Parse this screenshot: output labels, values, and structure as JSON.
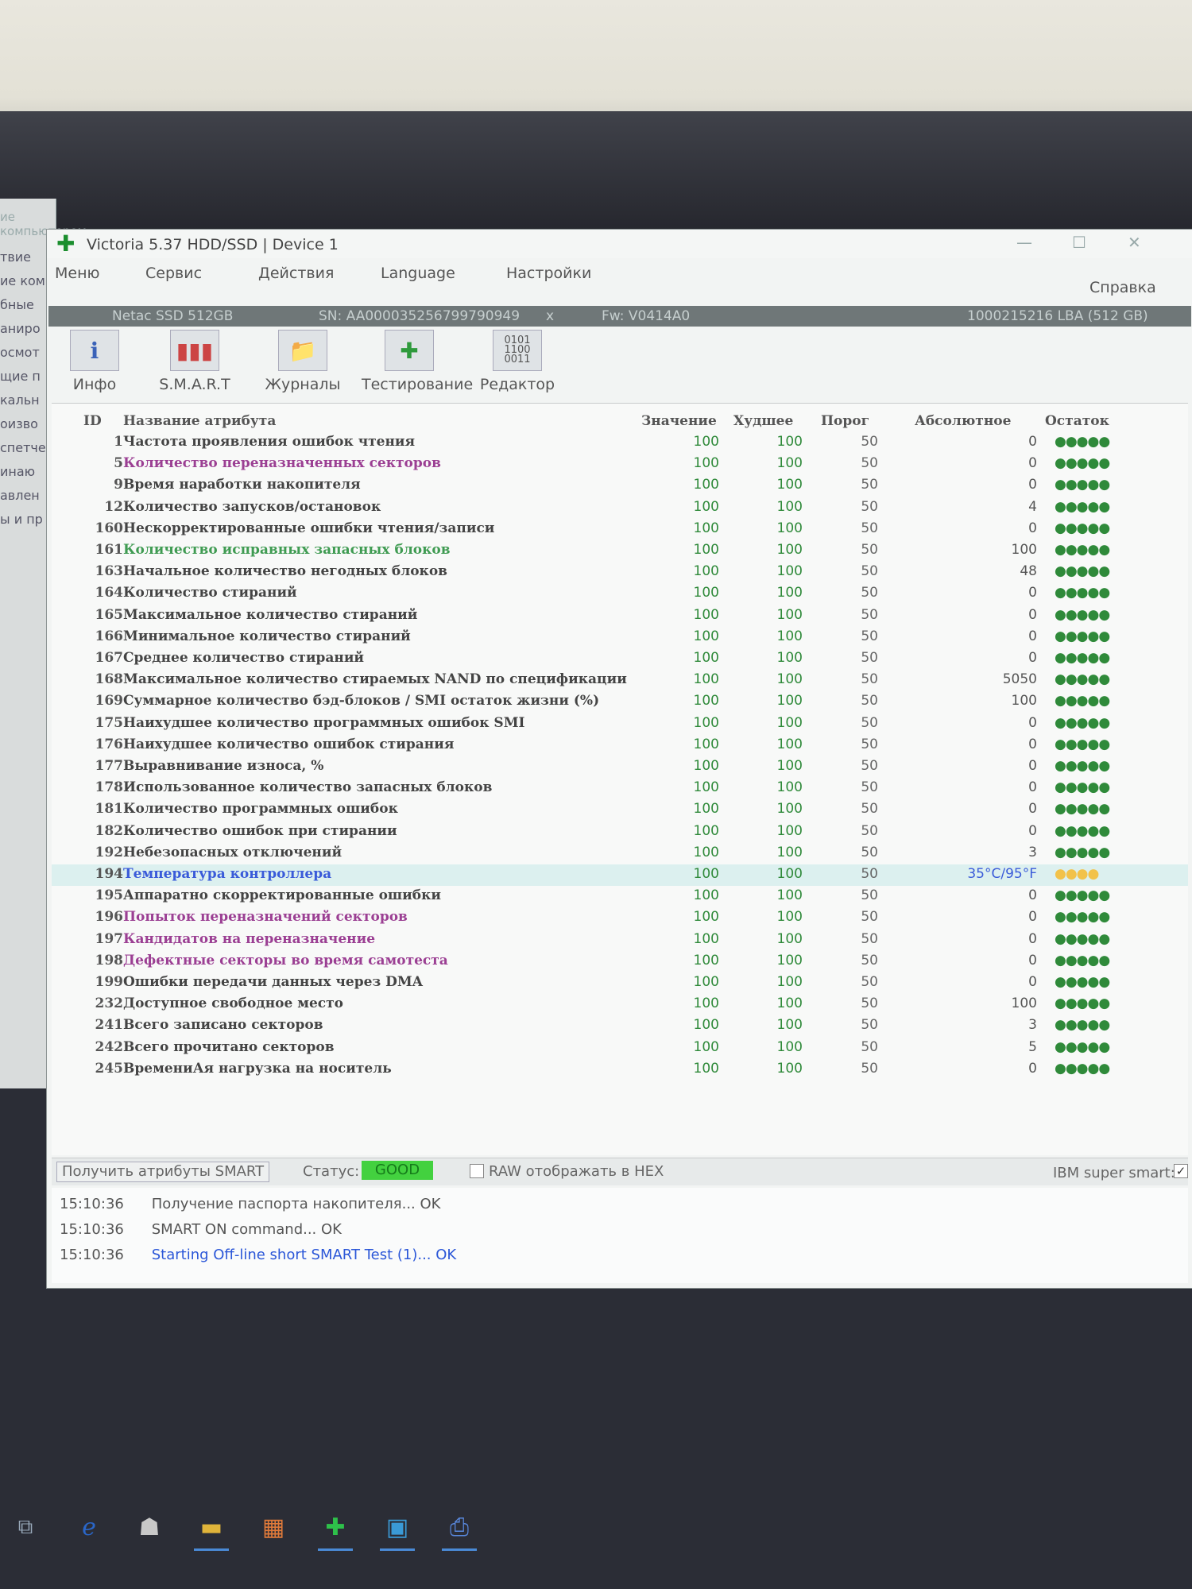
{
  "background_window": {
    "title": "ие компьютером",
    "lines": [
      "твие",
      "ие ком",
      "бные",
      "аниро",
      "осмот",
      "щие п",
      "кальн",
      "оизво",
      "спетче",
      "инаю",
      "авлен",
      "ы и пр"
    ]
  },
  "window": {
    "title": "Victoria 5.37 HDD/SSD | Device 1",
    "app_icon": "green-cross-icon",
    "controls": [
      "—",
      "☐",
      "✕"
    ]
  },
  "menu": [
    "Меню",
    "Сервис",
    "Действия",
    "Language",
    "Настройки",
    "Справка"
  ],
  "device": {
    "model": "Netac SSD 512GB",
    "serial": "SN: AA000035256799790949",
    "serial_close": "x",
    "firmware": "Fw: V0414A0",
    "capacity": "1000215216 LBA (512 GB)"
  },
  "toolbar": [
    {
      "label": "Инфо",
      "icon": "info-icon"
    },
    {
      "label": "S.M.A.R.T",
      "icon": "smart-chart-icon"
    },
    {
      "label": "Журналы",
      "icon": "logs-folder-icon"
    },
    {
      "label": "Тестирование",
      "icon": "test-icon"
    },
    {
      "label": "Редактор",
      "icon": "hex-editor-icon"
    }
  ],
  "smart_table": {
    "columns": [
      "ID",
      "Название атрибута",
      "Значение",
      "Худшее",
      "Порог",
      "Абсолютное",
      "Остаток"
    ],
    "rows": [
      {
        "id": "1",
        "name": "Частота проявления ошибок чтения",
        "value": "100",
        "worst": "100",
        "threshold": "50",
        "raw": "0",
        "remaining": "●●●●●",
        "name_color": "#444444"
      },
      {
        "id": "5",
        "name": "Количество переназначенных секторов",
        "value": "100",
        "worst": "100",
        "threshold": "50",
        "raw": "0",
        "remaining": "●●●●●",
        "name_color": "#9b3f93"
      },
      {
        "id": "9",
        "name": "Время наработки накопителя",
        "value": "100",
        "worst": "100",
        "threshold": "50",
        "raw": "0",
        "remaining": "●●●●●",
        "name_color": "#444444"
      },
      {
        "id": "12",
        "name": "Количество запусков/остановок",
        "value": "100",
        "worst": "100",
        "threshold": "50",
        "raw": "4",
        "remaining": "●●●●●",
        "name_color": "#444444"
      },
      {
        "id": "160",
        "name": "Нескорректированные ошибки чтения/записи",
        "value": "100",
        "worst": "100",
        "threshold": "50",
        "raw": "0",
        "remaining": "●●●●●",
        "name_color": "#444444"
      },
      {
        "id": "161",
        "name": "Количество исправных запасных блоков",
        "value": "100",
        "worst": "100",
        "threshold": "50",
        "raw": "100",
        "remaining": "●●●●●",
        "name_color": "#3f9b52"
      },
      {
        "id": "163",
        "name": "Начальное количество негодных блоков",
        "value": "100",
        "worst": "100",
        "threshold": "50",
        "raw": "48",
        "remaining": "●●●●●",
        "name_color": "#444444"
      },
      {
        "id": "164",
        "name": "Количество стираний",
        "value": "100",
        "worst": "100",
        "threshold": "50",
        "raw": "0",
        "remaining": "●●●●●",
        "name_color": "#444444"
      },
      {
        "id": "165",
        "name": "Максимальное количество стираний",
        "value": "100",
        "worst": "100",
        "threshold": "50",
        "raw": "0",
        "remaining": "●●●●●",
        "name_color": "#444444"
      },
      {
        "id": "166",
        "name": "Минимальное количество стираний",
        "value": "100",
        "worst": "100",
        "threshold": "50",
        "raw": "0",
        "remaining": "●●●●●",
        "name_color": "#444444"
      },
      {
        "id": "167",
        "name": "Среднее количество стираний",
        "value": "100",
        "worst": "100",
        "threshold": "50",
        "raw": "0",
        "remaining": "●●●●●",
        "name_color": "#444444"
      },
      {
        "id": "168",
        "name": "Максимальное количество стираемых NAND по спецификации",
        "value": "100",
        "worst": "100",
        "threshold": "50",
        "raw": "5050",
        "remaining": "●●●●●",
        "name_color": "#444444"
      },
      {
        "id": "169",
        "name": "Суммарное количество бэд-блоков / SMI остаток жизни (%)",
        "value": "100",
        "worst": "100",
        "threshold": "50",
        "raw": "100",
        "remaining": "●●●●●",
        "name_color": "#444444"
      },
      {
        "id": "175",
        "name": "Наихудшее количество программных ошибок SMI",
        "value": "100",
        "worst": "100",
        "threshold": "50",
        "raw": "0",
        "remaining": "●●●●●",
        "name_color": "#444444"
      },
      {
        "id": "176",
        "name": "Наихудшее количество ошибок стирания",
        "value": "100",
        "worst": "100",
        "threshold": "50",
        "raw": "0",
        "remaining": "●●●●●",
        "name_color": "#444444"
      },
      {
        "id": "177",
        "name": "Выравнивание износа, %",
        "value": "100",
        "worst": "100",
        "threshold": "50",
        "raw": "0",
        "remaining": "●●●●●",
        "name_color": "#444444"
      },
      {
        "id": "178",
        "name": "Использованное количество запасных блоков",
        "value": "100",
        "worst": "100",
        "threshold": "50",
        "raw": "0",
        "remaining": "●●●●●",
        "name_color": "#444444"
      },
      {
        "id": "181",
        "name": "Количество программных ошибок",
        "value": "100",
        "worst": "100",
        "threshold": "50",
        "raw": "0",
        "remaining": "●●●●●",
        "name_color": "#444444"
      },
      {
        "id": "182",
        "name": "Количество ошибок при стирании",
        "value": "100",
        "worst": "100",
        "threshold": "50",
        "raw": "0",
        "remaining": "●●●●●",
        "name_color": "#444444"
      },
      {
        "id": "192",
        "name": "Небезопасных отключений",
        "value": "100",
        "worst": "100",
        "threshold": "50",
        "raw": "3",
        "remaining": "●●●●●",
        "name_color": "#444444"
      },
      {
        "id": "194",
        "name": "Температура контроллера",
        "value": "100",
        "worst": "100",
        "threshold": "50",
        "raw": "35°C/95°F",
        "remaining": "●●●●",
        "name_color": "#3a5bd9",
        "raw_color": "#3a5bd9",
        "remaining_color": "#f2c24a",
        "highlight": true
      },
      {
        "id": "195",
        "name": "Аппаратно скорректированные ошибки",
        "value": "100",
        "worst": "100",
        "threshold": "50",
        "raw": "0",
        "remaining": "●●●●●",
        "name_color": "#444444"
      },
      {
        "id": "196",
        "name": "Попыток переназначений секторов",
        "value": "100",
        "worst": "100",
        "threshold": "50",
        "raw": "0",
        "remaining": "●●●●●",
        "name_color": "#9b3f93"
      },
      {
        "id": "197",
        "name": "Кандидатов на переназначение",
        "value": "100",
        "worst": "100",
        "threshold": "50",
        "raw": "0",
        "remaining": "●●●●●",
        "name_color": "#9b3f93"
      },
      {
        "id": "198",
        "name": "Дефектные секторы во время самотеста",
        "value": "100",
        "worst": "100",
        "threshold": "50",
        "raw": "0",
        "remaining": "●●●●●",
        "name_color": "#9b3f93"
      },
      {
        "id": "199",
        "name": "Ошибки передачи данных через DMA",
        "value": "100",
        "worst": "100",
        "threshold": "50",
        "raw": "0",
        "remaining": "●●●●●",
        "name_color": "#444444"
      },
      {
        "id": "232",
        "name": "Доступное свободное место",
        "value": "100",
        "worst": "100",
        "threshold": "50",
        "raw": "100",
        "remaining": "●●●●●",
        "name_color": "#444444"
      },
      {
        "id": "241",
        "name": "Всего записано секторов",
        "value": "100",
        "worst": "100",
        "threshold": "50",
        "raw": "3",
        "remaining": "●●●●●",
        "name_color": "#444444"
      },
      {
        "id": "242",
        "name": "Всего прочитано секторов",
        "value": "100",
        "worst": "100",
        "threshold": "50",
        "raw": "5",
        "remaining": "●●●●●",
        "name_color": "#444444"
      },
      {
        "id": "245",
        "name": "ВремениАя нагрузка на носитель",
        "value": "100",
        "worst": "100",
        "threshold": "50",
        "raw": "0",
        "remaining": "●●●●●",
        "name_color": "#444444"
      }
    ]
  },
  "status_bar": {
    "get_smart_button": "Получить атрибуты SMART",
    "status_label": "Статус:",
    "status_value": "GOOD",
    "raw_hex_label": "RAW отображать в HEX",
    "ibm_label": "IBM super smart:",
    "ibm_checked": "✓"
  },
  "log": [
    {
      "time": "15:10:36",
      "message": "Получение паспорта накопителя... OK"
    },
    {
      "time": "15:10:36",
      "message": "SMART ON command... OK"
    },
    {
      "time": "15:10:36",
      "message": "Starting Off-line short SMART Test (1)... OK",
      "color": "blue"
    }
  ],
  "taskbar": [
    {
      "icon": "task-view-icon"
    },
    {
      "icon": "edge-browser-icon"
    },
    {
      "icon": "app-icon"
    },
    {
      "icon": "file-explorer-icon"
    },
    {
      "icon": "store-icon"
    },
    {
      "icon": "victoria-icon"
    },
    {
      "icon": "monitor-app-icon"
    },
    {
      "icon": "printer-icon"
    }
  ]
}
